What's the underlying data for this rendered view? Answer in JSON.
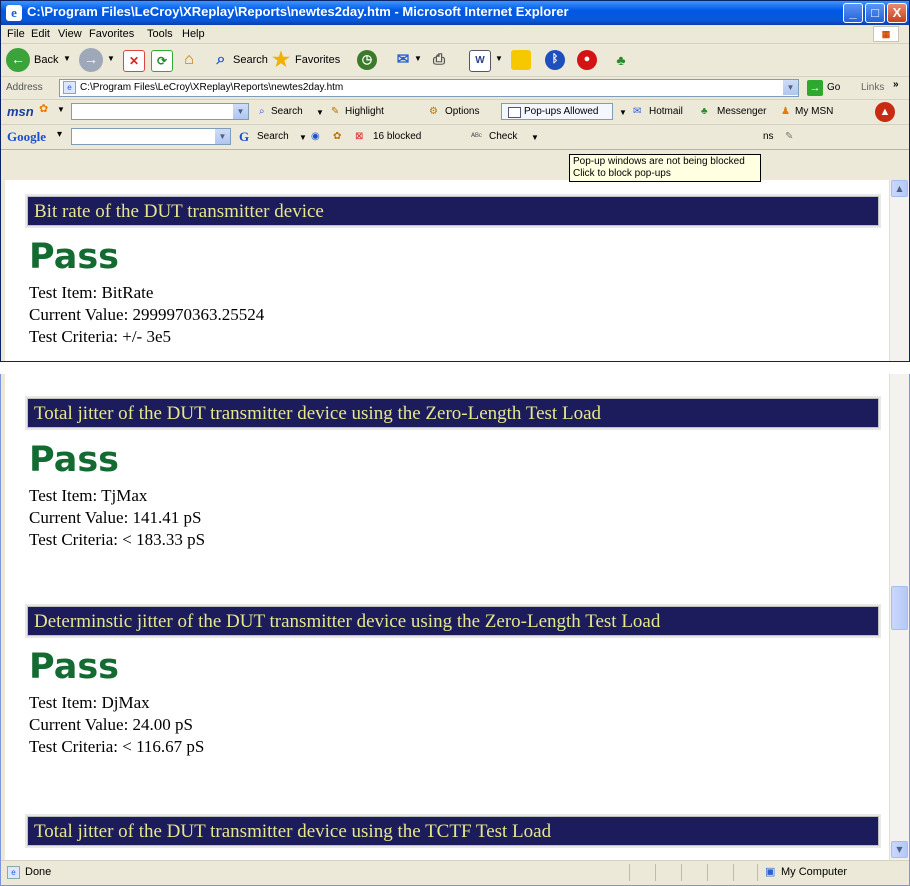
{
  "window": {
    "title": "C:\\Program Files\\LeCroy\\XReplay\\Reports\\newtes2day.htm - Microsoft Internet Explorer",
    "min": "_",
    "max": "□",
    "close": "X"
  },
  "menubar": {
    "items": [
      "File",
      "Edit",
      "View",
      "Favorites",
      "Tools",
      "Help"
    ]
  },
  "toolbar": {
    "back_label": "Back",
    "search_label": "Search",
    "favorites_label": "Favorites"
  },
  "address": {
    "label": "Address",
    "url": "C:\\Program Files\\LeCroy\\XReplay\\Reports\\newtes2day.htm",
    "go_label": "Go",
    "links_label": "Links"
  },
  "msnbar": {
    "logo": "msn",
    "search_label": "Search",
    "highlight_label": "Highlight",
    "options_label": "Options",
    "popups_label": "Pop-ups Allowed",
    "hotmail_label": "Hotmail",
    "messenger_label": "Messenger",
    "mymsn_label": "My MSN"
  },
  "googlebar": {
    "logo": "Google",
    "search_label": "Search",
    "blocked_label": "16 blocked",
    "check_label": "Check",
    "trailing_text": "ns"
  },
  "tooltip": {
    "line1": "Pop-up windows are not being blocked",
    "line2": "Click to block pop-ups"
  },
  "report": {
    "sections": [
      {
        "header": "Bit rate of the DUT transmitter device",
        "result": "Pass",
        "item": "Test Item: BitRate",
        "value": "Current Value: 2999970363.25524",
        "criteria": "Test Criteria: +/- 3e5"
      },
      {
        "header": "Total jitter of the DUT transmitter device using the Zero-Length Test Load",
        "result": "Pass",
        "item": "Test Item: TjMax",
        "value": "Current Value: 141.41 pS",
        "criteria": "Test Criteria: < 183.33 pS"
      },
      {
        "header": "Determinstic jitter of the DUT transmitter device using the Zero-Length Test Load",
        "result": "Pass",
        "item": "Test Item: DjMax",
        "value": "Current Value: 24.00 pS",
        "criteria": "Test Criteria: < 116.67 pS"
      },
      {
        "header": "Total jitter of the DUT transmitter device using the TCTF Test Load"
      }
    ]
  },
  "statusbar": {
    "text": "Done",
    "zone": "My Computer"
  },
  "colors": {
    "header_bg": "#1c1c5c",
    "header_text": "#e6e68a",
    "pass_green": "#146b32",
    "xp_blue": "#0058e6"
  }
}
